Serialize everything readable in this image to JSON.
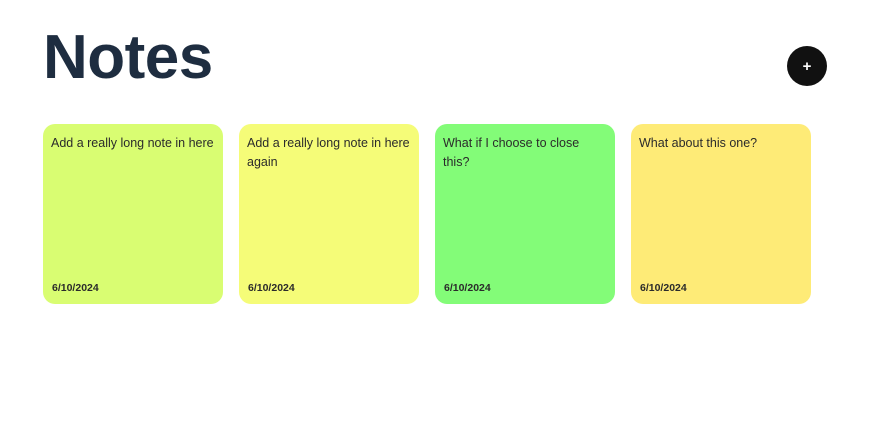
{
  "header": {
    "title": "Notes",
    "add_label": "+"
  },
  "notes": [
    {
      "text": "Add a really long note in here",
      "date": "6/10/2024",
      "color": "#d9fd72"
    },
    {
      "text": "Add a really long note in here again",
      "date": "6/10/2024",
      "color": "#f5fc78"
    },
    {
      "text": "What if I choose to close this?",
      "date": "6/10/2024",
      "color": "#83fc78"
    },
    {
      "text": "What about this one?",
      "date": "6/10/2024",
      "color": "#feeb77"
    }
  ]
}
